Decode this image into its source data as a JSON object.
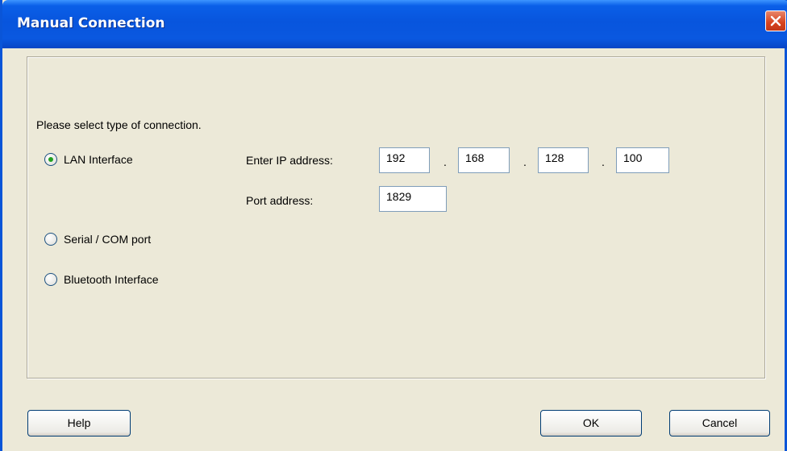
{
  "window": {
    "title": "Manual Connection"
  },
  "prompt": "Please select type of connection.",
  "options": [
    {
      "label": "LAN Interface",
      "selected": true
    },
    {
      "label": "Serial / COM port",
      "selected": false
    },
    {
      "label": "Bluetooth Interface",
      "selected": false
    }
  ],
  "lan": {
    "ip_label": "Enter IP address:",
    "ip": [
      "192",
      "168",
      "128",
      "100"
    ],
    "dot": ".",
    "port_label": "Port address:",
    "port": "1829"
  },
  "buttons": {
    "help": "Help",
    "ok": "OK",
    "cancel": "Cancel"
  },
  "colors": {
    "titlebar": "#0a5fe8",
    "close": "#d6431e",
    "face": "#ece9d8"
  }
}
